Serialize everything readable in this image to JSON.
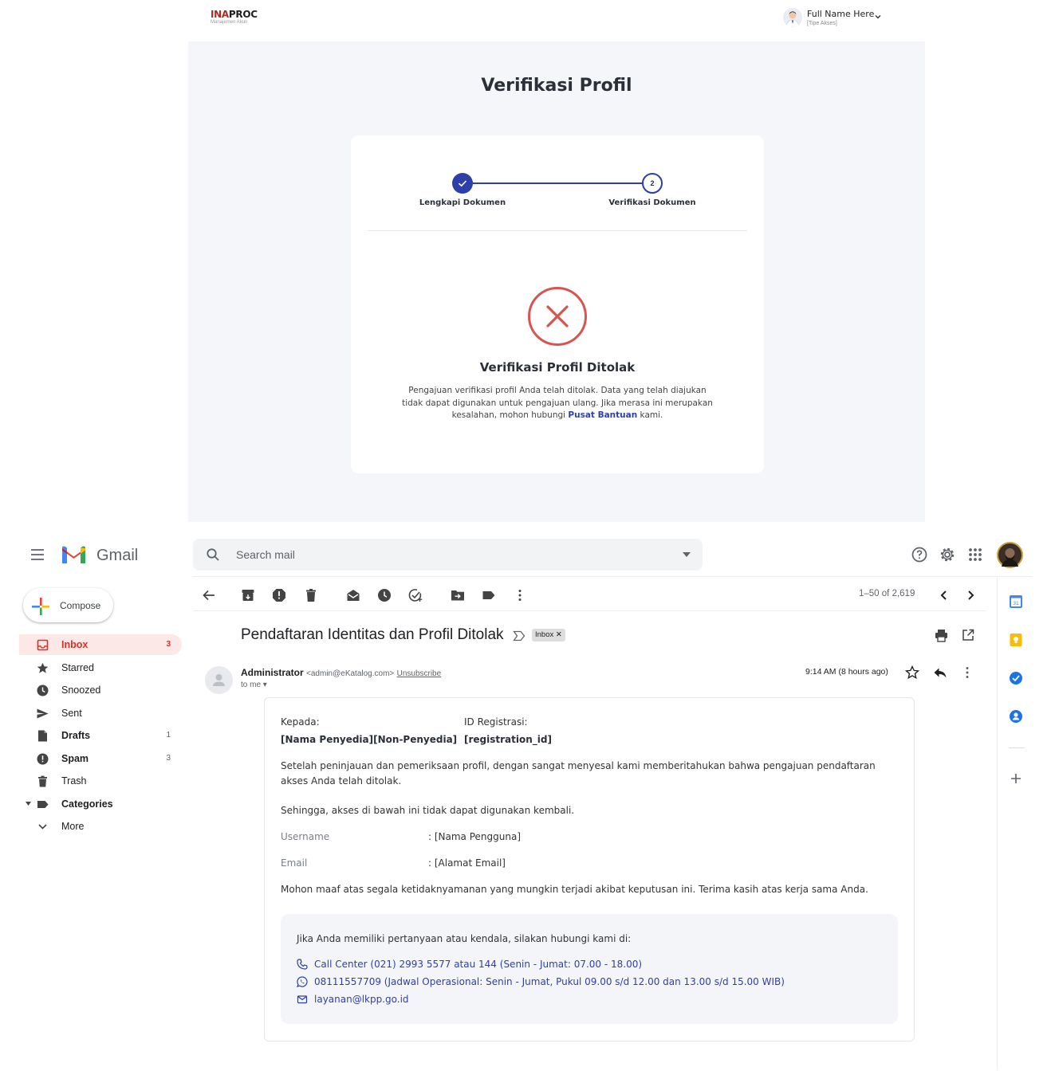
{
  "inaproc": {
    "logo_ina": "INA",
    "logo_proc": "PROC",
    "logo_subtitle": "Manajemen Akun",
    "user_name": "Full Name Here",
    "user_type": "[Tipe Akses]",
    "page_title": "Verifikasi Profil",
    "steps": [
      {
        "number": "1",
        "label": "Lengkapi Dokumen",
        "state": "completed"
      },
      {
        "number": "2",
        "label": "Verifikasi Dokumen",
        "state": "current"
      }
    ],
    "result_title": "Verifikasi Profil Ditolak",
    "result_text_before": "Pengajuan verifikasi profil Anda telah ditolak. Data yang telah diajukan tidak dapat digunakan untuk pengajuan ulang. Jika merasa ini merupakan kesalahan, mohon hubungi ",
    "result_link": "Pusat Bantuan",
    "result_text_after": " kami.",
    "colors": {
      "primary": "#2f3fa8",
      "error": "#d9534f",
      "background": "#f5f6fa"
    }
  },
  "gmail": {
    "app_name": "Gmail",
    "search_placeholder": "Search mail",
    "compose_label": "Compose",
    "nav": [
      {
        "label": "Inbox",
        "count": "3",
        "icon": "inbox-icon",
        "active": true,
        "bold": true
      },
      {
        "label": "Starred",
        "count": "",
        "icon": "star-icon",
        "active": false,
        "bold": false
      },
      {
        "label": "Snoozed",
        "count": "",
        "icon": "clock-icon",
        "active": false,
        "bold": false
      },
      {
        "label": "Sent",
        "count": "",
        "icon": "send-icon",
        "active": false,
        "bold": false
      },
      {
        "label": "Drafts",
        "count": "1",
        "icon": "draft-icon",
        "active": false,
        "bold": true
      },
      {
        "label": "Spam",
        "count": "3",
        "icon": "spam-icon",
        "active": false,
        "bold": true
      },
      {
        "label": "Trash",
        "count": "",
        "icon": "trash-icon",
        "active": false,
        "bold": false
      },
      {
        "label": "Categories",
        "count": "",
        "icon": "label-icon",
        "active": false,
        "bold": true
      },
      {
        "label": "More",
        "count": "",
        "icon": "chevron-down-icon",
        "active": false,
        "bold": false
      }
    ],
    "pager": "1–50 of 2,619",
    "subject": "Pendaftaran Identitas dan Profil Ditolak",
    "chip": "Inbox ✕",
    "sender_name": "Administrator",
    "sender_email": "<admin@eKatalog.com>",
    "unsubscribe": "Unsubscribe",
    "to_me": "to me ▾",
    "time": "9:14 AM (8 hours ago)",
    "body": {
      "to_label": "Kepada:",
      "to_value": "[Nama Penyedia][Non-Penyedia]",
      "reg_label": "ID Registrasi:",
      "reg_value": "[registration_id]",
      "p1": "Setelah peninjauan dan pemeriksaan profil, dengan sangat menyesal kami memberitahukan bahwa pengajuan pendaftaran akses Anda telah ditolak.",
      "p2": "Sehingga, akses di bawah ini tidak dapat digunakan kembali.",
      "username_label": "Username",
      "username_value": ":  [Nama Pengguna]",
      "email_label": "Email",
      "email_value": ":  [Alamat Email]",
      "p3": "Mohon maaf atas segala ketidaknyamanan yang mungkin terjadi akibat keputusan ini. Terima kasih atas kerja sama Anda.",
      "contact_intro": "Jika Anda memiliki pertanyaan atau kendala, silakan hubungi kami di:",
      "contact_phone": "Call Center (021) 2993 5577 atau 144 (Senin - Jumat: 07.00 - 18.00)",
      "contact_whatsapp": "08111557709 (Jadwal Operasional: Senin - Jumat, Pukul 09.00 s/d 12.00 dan  13.00 s/d 15.00 WIB)",
      "contact_email": "layanan@lkpp.go.id"
    }
  }
}
